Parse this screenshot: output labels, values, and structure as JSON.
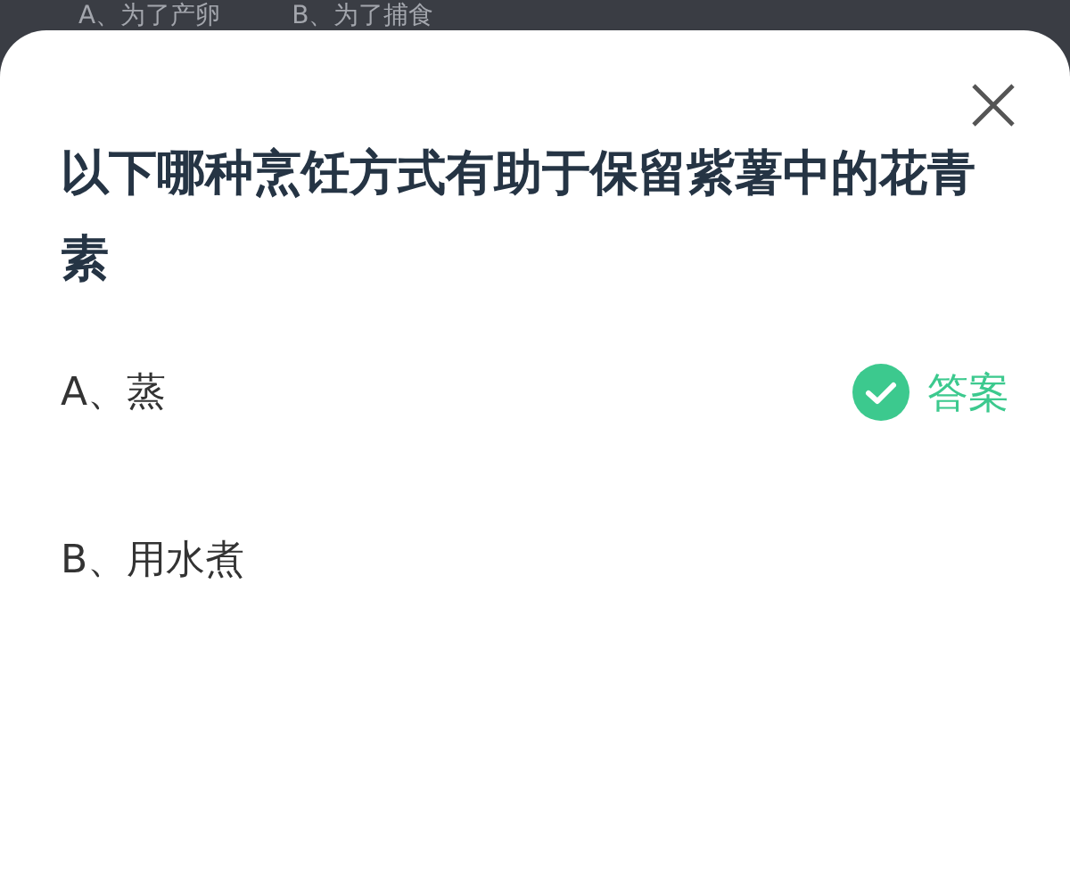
{
  "background_options": [
    "A、为了产卵",
    "B、为了捕食"
  ],
  "question": "以下哪种烹饪方式有助于保留紫薯中的花青素",
  "answer_label": "答案",
  "options": [
    {
      "label": "A、蒸",
      "correct": true
    },
    {
      "label": "B、用水煮",
      "correct": false
    }
  ]
}
